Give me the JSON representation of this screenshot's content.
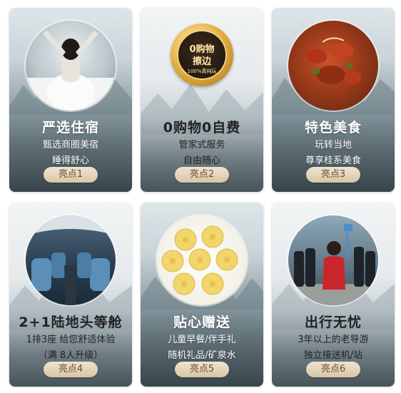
{
  "cards": [
    {
      "title": "严选住宿",
      "lines": [
        "甄选商圈美宿",
        "睡得舒心"
      ],
      "badge": "亮点1",
      "image": "woman-stretching-on-bed-photo"
    },
    {
      "title": "0购物0自费",
      "lines": [
        "管家式服务",
        "自由随心"
      ],
      "badge": "亮点2",
      "image": "gold-medal-icon",
      "medal": {
        "line1": "0购物",
        "line2": "擦边",
        "line3": "100%真纯玩"
      }
    },
    {
      "title": "特色美食",
      "lines": [
        "玩转当地",
        "尊享桂系美食"
      ],
      "badge": "亮点3",
      "image": "braised-dish-photo"
    },
    {
      "title": "2+1陆地头等舱",
      "lines": [
        "1排3座  给您舒适体验",
        "（满 8人升级）"
      ],
      "badge": "亮点4",
      "image": "coach-bus-interior-photo"
    },
    {
      "title": "贴心赠送",
      "lines": [
        "儿童早餐/伴手礼",
        "随机礼品/矿泉水"
      ],
      "badge": "亮点5",
      "image": "flower-cakes-photo"
    },
    {
      "title": "出行无忧",
      "lines": [
        "3年以上的老导游",
        "独立接送机/站"
      ],
      "badge": "亮点6",
      "image": "tour-group-photo"
    }
  ],
  "colors": {
    "badge_bg": "#e4d3b8",
    "badge_text": "#6e4b2a",
    "title_light": "#ffffff",
    "title_dark": "#222222"
  }
}
